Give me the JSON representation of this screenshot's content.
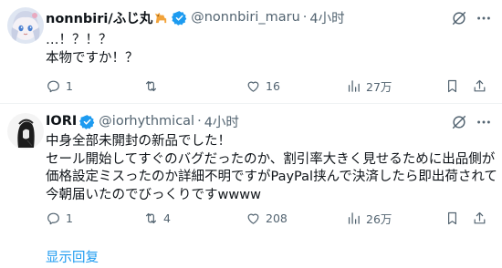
{
  "tweets": [
    {
      "display_name": "nonnbiri/ふじ丸",
      "handle": "@nonnbiri_maru",
      "separator": "·",
      "time": "4小时",
      "lines": [
        "…！？！？",
        "本物ですか！？"
      ],
      "replies": "1",
      "retweets": "",
      "likes": "16",
      "views": "27万"
    },
    {
      "display_name": "IORI",
      "handle": "@iorhythmical",
      "separator": "·",
      "time": "4小时",
      "lines": [
        "中身全部未開封の新品でした！",
        "セール開始してすぐのバグだったのか、割引率大きく見せるために出品側が",
        "価格設定ミスったのか詳細不明ですがPayPal挟んで決済したら即出荷されて",
        "今朝届いたのでびっくりですwwww"
      ],
      "replies": "1",
      "retweets": "4",
      "likes": "208",
      "views": "26万"
    }
  ],
  "show_replies_label": "显示回复",
  "colors": {
    "text": "#0f1419",
    "secondary": "#536471",
    "accent": "#1d9bf0",
    "verified": "#1d9bf0",
    "divider": "#eff3f4"
  },
  "icons": [
    "dog-emoji-icon",
    "verified-badge-icon",
    "grok-icon",
    "more-icon",
    "reply-icon",
    "retweet-icon",
    "like-icon",
    "views-icon",
    "bookmark-icon",
    "share-icon"
  ]
}
